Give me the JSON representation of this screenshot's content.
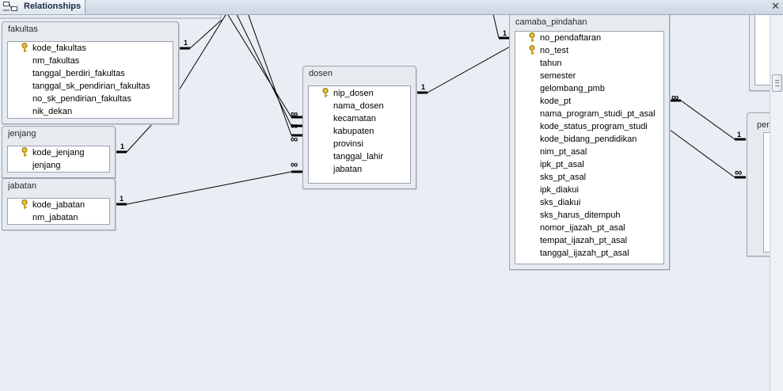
{
  "tab": {
    "label": "Relationships",
    "icon": "relationships-icon"
  },
  "close_icon": "close-icon",
  "tables": {
    "fakultas": {
      "title": "fakultas",
      "fields": [
        "kode_fakultas",
        "nm_fakultas",
        "tanggal_berdiri_fakultas",
        "tanggal_sk_pendirian_fakultas",
        "no_sk_pendirian_fakultas",
        "nik_dekan"
      ],
      "keys": [
        0
      ]
    },
    "jenjang": {
      "title": "jenjang",
      "fields": [
        "kode_jenjang",
        "jenjang"
      ],
      "keys": [
        0
      ]
    },
    "jabatan": {
      "title": "jabatan",
      "fields": [
        "kode_jabatan",
        "nm_jabatan"
      ],
      "keys": [
        0
      ]
    },
    "dosen": {
      "title": "dosen",
      "fields": [
        "nip_dosen",
        "nama_dosen",
        "kecamatan",
        "kabupaten",
        "provinsi",
        "tanggal_lahir",
        "jabatan"
      ],
      "keys": [
        0
      ]
    },
    "camaba_pindahan": {
      "title": "camaba_pindahan",
      "fields": [
        "no_pendaftaran",
        "no_test",
        "tahun",
        "semester",
        "gelombang_pmb",
        "kode_pt",
        "nama_program_studi_pt_asal",
        "kode_status_program_studi",
        "kode_bidang_pendidikan",
        "nim_pt_asal",
        "ipk_pt_asal",
        "sks_pt_asal",
        "ipk_diakui",
        "sks_diakui",
        "sks_harus_ditempuh",
        "nomor_ijazah_pt_asal",
        "tempat_ijazah_pt_asal",
        "tanggal_ijazah_pt_asal"
      ],
      "keys": [
        0,
        1
      ]
    },
    "partial_right": {
      "title": "pen"
    }
  },
  "relationship_labels": {
    "one": "1",
    "many": "∞"
  }
}
